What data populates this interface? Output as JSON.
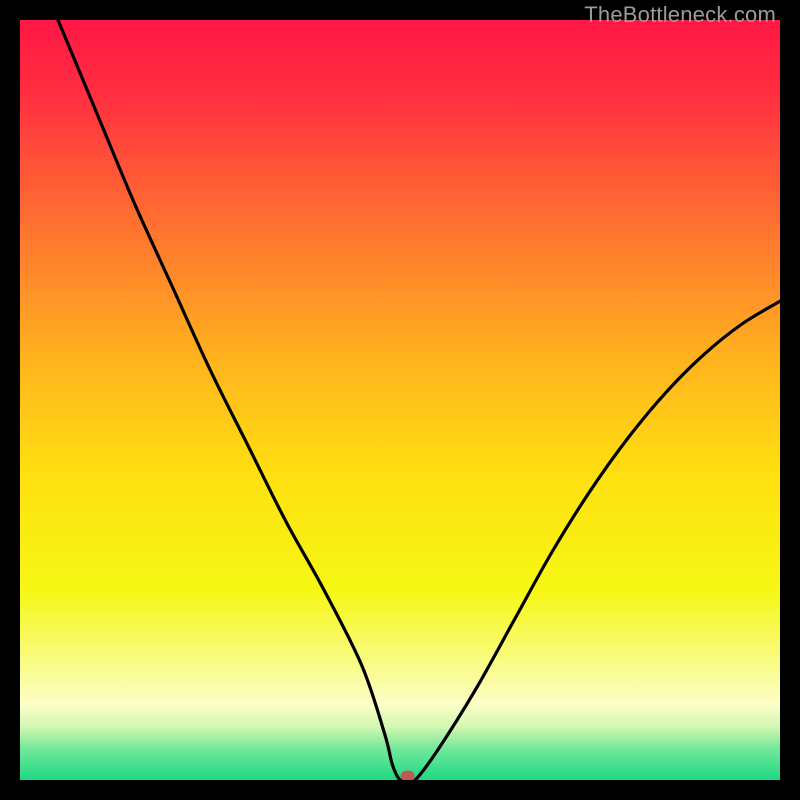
{
  "watermark": "TheBottleneck.com",
  "chart_data": {
    "type": "line",
    "title": "",
    "xlabel": "",
    "ylabel": "",
    "xlim": [
      0,
      100
    ],
    "ylim": [
      0,
      100
    ],
    "grid": false,
    "series": [
      {
        "name": "bottleneck-curve",
        "x": [
          5,
          10,
          15,
          20,
          25,
          30,
          35,
          40,
          45,
          48,
          49,
          50,
          51,
          52,
          55,
          60,
          65,
          70,
          75,
          80,
          85,
          90,
          95,
          100
        ],
        "y": [
          100,
          88,
          76,
          65,
          54,
          44,
          34,
          25,
          15,
          6,
          2,
          0,
          0,
          0,
          4,
          12,
          21,
          30,
          38,
          45,
          51,
          56,
          60,
          63
        ]
      }
    ],
    "marker": {
      "x": 51,
      "y": 0,
      "color": "#c15a52"
    },
    "background_gradient": {
      "stops": [
        {
          "pos": 0.0,
          "color": "#ff1745"
        },
        {
          "pos": 0.1,
          "color": "#ff2f40"
        },
        {
          "pos": 0.25,
          "color": "#ff6a32"
        },
        {
          "pos": 0.45,
          "color": "#ffb41e"
        },
        {
          "pos": 0.6,
          "color": "#ffe010"
        },
        {
          "pos": 0.75,
          "color": "#f6f714"
        },
        {
          "pos": 0.85,
          "color": "#f9fc89"
        },
        {
          "pos": 0.9,
          "color": "#fcffc8"
        },
        {
          "pos": 0.93,
          "color": "#d3f7b1"
        },
        {
          "pos": 0.96,
          "color": "#6fe898"
        },
        {
          "pos": 1.0,
          "color": "#1fd885"
        }
      ]
    }
  }
}
